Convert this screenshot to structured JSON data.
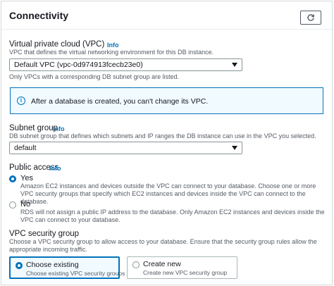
{
  "header": {
    "title": "Connectivity",
    "refresh_icon": "refresh-icon"
  },
  "vpc": {
    "label": "Virtual private cloud (VPC)",
    "info": "Info",
    "description": "VPC that defines the virtual networking environment for this DB instance.",
    "selected": "Default VPC (vpc-0d974913fcecb23e0)",
    "note": "Only VPCs with a corresponding DB subnet group are listed."
  },
  "alert": {
    "icon": "info-circle-icon",
    "text": "After a database is created, you can't change its VPC."
  },
  "subnet": {
    "label": "Subnet group",
    "info": "Info",
    "description": "DB subnet group that defines which subnets and IP ranges the DB instance can use in the VPC you selected.",
    "selected": "default"
  },
  "public_access": {
    "label": "Public access",
    "info": "Info",
    "options": [
      {
        "label": "Yes",
        "selected": true,
        "description": "Amazon EC2 instances and devices outside the VPC can connect to your database. Choose one or more VPC security groups that specify which EC2 instances and devices inside the VPC can connect to the database."
      },
      {
        "label": "No",
        "selected": false,
        "description": "RDS will not assign a public IP address to the database. Only Amazon EC2 instances and devices inside the VPC can connect to your database."
      }
    ]
  },
  "security_group": {
    "label": "VPC security group",
    "description": "Choose a VPC security group to allow access to your database. Ensure that the security group rules allow the appropriate incoming traffic.",
    "tiles": [
      {
        "title": "Choose existing",
        "description": "Choose existing VPC security groups",
        "selected": true
      },
      {
        "title": "Create new",
        "description": "Create new VPC security group",
        "selected": false
      }
    ]
  },
  "colors": {
    "accent": "#0073bb",
    "alert_bg": "#f1faff",
    "border": "#d5dbdb",
    "text": "#16191f",
    "muted_text": "#545b64"
  }
}
